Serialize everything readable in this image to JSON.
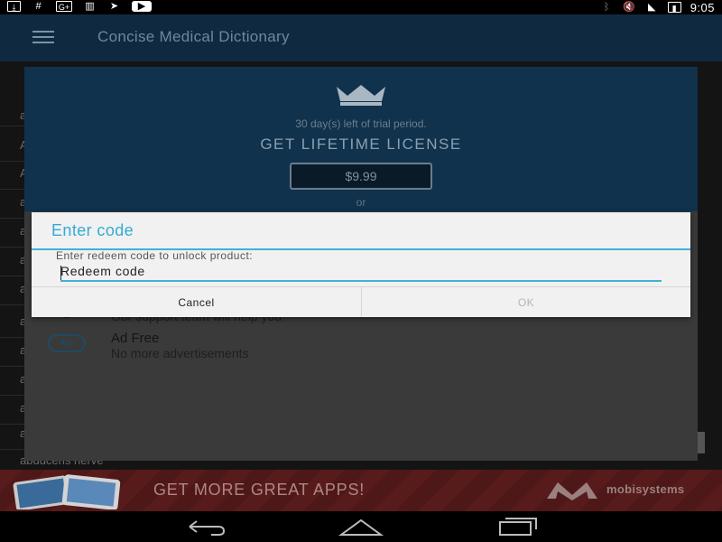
{
  "status_bar": {
    "left_icons": [
      "download-icon",
      "hashtag-icon",
      "google-plus-icon",
      "barcode-icon",
      "send-icon",
      "youtube-icon"
    ],
    "right_icons": [
      "bluetooth-icon",
      "mute-icon",
      "wifi-icon",
      "battery-icon"
    ],
    "time": "9:05"
  },
  "app_bar": {
    "title": "Concise Medical Dictionary"
  },
  "premium_panel": {
    "trial_text": "30 day(s) left of trial period.",
    "lifetime_heading": "GET LIFETIME LICENSE",
    "price": "$9.99",
    "or_text": "or",
    "features": [
      {
        "title": "",
        "subtitle": "Our support team will help you"
      },
      {
        "title": "Ad Free",
        "subtitle": "No more advertisements"
      }
    ],
    "ads_icon_label": "Ads"
  },
  "dialog": {
    "title": "Enter code",
    "message": "Enter redeem code to unlock product:",
    "input_value": "Redeem code",
    "cancel_label": "Cancel",
    "ok_label": "OK"
  },
  "background_list": {
    "first_letters": [
      "a",
      "A",
      "A",
      "a",
      "a",
      "a",
      "a",
      "a",
      "a",
      "a",
      "a",
      "a"
    ],
    "bottom_word": "abducens nerve"
  },
  "ad_banner": {
    "text": "GET MORE GREAT APPS!",
    "brand": "mobisystems"
  },
  "nav_bar": {
    "buttons": [
      "back-icon",
      "home-icon",
      "recents-icon"
    ]
  },
  "colors": {
    "accent": "#35aad5",
    "app_bar": "#0f2a40",
    "dialog_bg": "#f1f1f1"
  }
}
